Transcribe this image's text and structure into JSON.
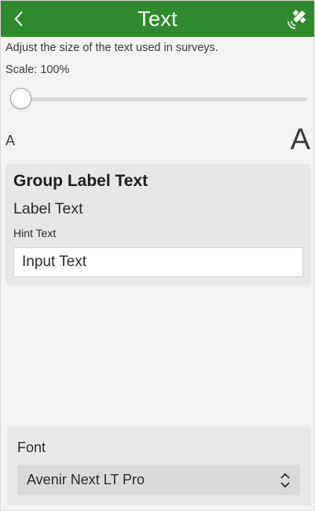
{
  "header": {
    "title": "Text",
    "back_icon": "chevron-left-icon",
    "status_icon": "satellite-gps-icon",
    "background_color": "#2f8a2d"
  },
  "description": "Adjust the size of the text used in surveys.",
  "scale": {
    "label": "Scale: 100%",
    "value_fraction": 0.0
  },
  "size_indicators": {
    "small": "A",
    "large": "A"
  },
  "preview": {
    "group_label": "Group Label Text",
    "label": "Label Text",
    "hint": "Hint Text",
    "input_value": "Input Text"
  },
  "font": {
    "label": "Font",
    "selected": "Avenir Next LT Pro",
    "select_icon": "up-down-chevrons-icon"
  }
}
